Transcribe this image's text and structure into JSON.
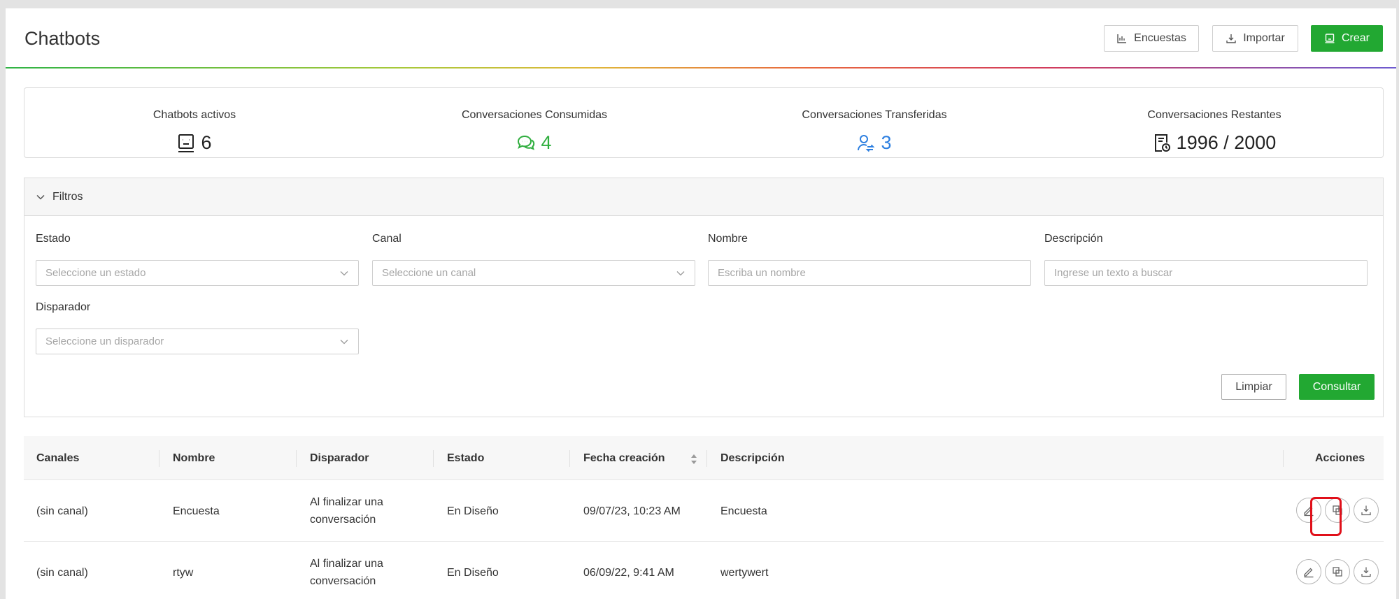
{
  "header": {
    "title": "Chatbots",
    "buttons": {
      "encuestas": "Encuestas",
      "importar": "Importar",
      "crear": "Crear"
    }
  },
  "stats": [
    {
      "label": "Chatbots activos",
      "value": "6",
      "icon": "robot-icon",
      "color": "#222222"
    },
    {
      "label": "Conversaciones Consumidas",
      "value": "4",
      "icon": "chat-bubbles-icon",
      "color": "#2fae3e"
    },
    {
      "label": "Conversaciones Transferidas",
      "value": "3",
      "icon": "user-transfer-icon",
      "color": "#2d7fe0"
    },
    {
      "label": "Conversaciones Restantes",
      "value": "1996 / 2000",
      "icon": "document-clock-icon",
      "color": "#222222"
    }
  ],
  "filters": {
    "title": "Filtros",
    "estado": {
      "label": "Estado",
      "placeholder": "Seleccione un estado"
    },
    "canal": {
      "label": "Canal",
      "placeholder": "Seleccione un canal"
    },
    "nombre": {
      "label": "Nombre",
      "placeholder": "Escriba un nombre"
    },
    "descripcion": {
      "label": "Descripción",
      "placeholder": "Ingrese un texto a buscar"
    },
    "disparador": {
      "label": "Disparador",
      "placeholder": "Seleccione un disparador"
    },
    "limpiar": "Limpiar",
    "consultar": "Consultar"
  },
  "table": {
    "columns": [
      "Canales",
      "Nombre",
      "Disparador",
      "Estado",
      "Fecha creación",
      "Descripción",
      "Acciones"
    ],
    "rows": [
      {
        "canal": "(sin canal)",
        "nombre": "Encuesta",
        "disparador": "Al finalizar una conversación",
        "estado": "En Diseño",
        "fecha": "09/07/23, 10:23 AM",
        "descripcion": "Encuesta"
      },
      {
        "canal": "(sin canal)",
        "nombre": "rtyw",
        "disparador": "Al finalizar una conversación",
        "estado": "En Diseño",
        "fecha": "06/09/22, 9:41 AM",
        "descripcion": "wertywert"
      }
    ]
  },
  "colors": {
    "accent_green": "#22a832",
    "highlight_red": "#e0101a"
  }
}
